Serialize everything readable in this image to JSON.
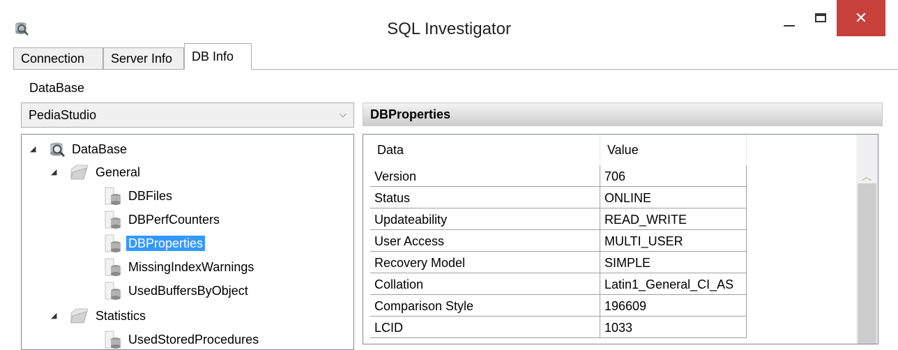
{
  "window": {
    "title": "SQL Investigator",
    "close_glyph": "✕"
  },
  "tabs": [
    {
      "label": "Connection"
    },
    {
      "label": "Server Info"
    },
    {
      "label": "DB Info"
    }
  ],
  "database_label": "DataBase",
  "database_select": {
    "value": "PediaStudio",
    "arrow": "⌵"
  },
  "tree": {
    "root": "DataBase",
    "general": "General",
    "items": [
      "DBFiles",
      "DBPerfCounters",
      "DBProperties",
      "MissingIndexWarnings",
      "UsedBuffersByObject"
    ],
    "selected": "DBProperties",
    "statistics": "Statistics",
    "partial_last": "UsedStoredProcedures"
  },
  "panel": {
    "title": "DBProperties"
  },
  "grid": {
    "columns": [
      "Data",
      "Value"
    ],
    "rows": [
      {
        "data": "Version",
        "value": "706"
      },
      {
        "data": "Status",
        "value": "ONLINE"
      },
      {
        "data": "Updateability",
        "value": "READ_WRITE"
      },
      {
        "data": "User Access",
        "value": "MULTI_USER"
      },
      {
        "data": "Recovery Model",
        "value": "SIMPLE"
      },
      {
        "data": "Collation",
        "value": "Latin1_General_CI_AS"
      },
      {
        "data": "Comparison Style",
        "value": "196609"
      },
      {
        "data": "LCID",
        "value": "1033"
      }
    ]
  },
  "colors": {
    "selection": "#3399ff",
    "close_button": "#c7403a"
  }
}
